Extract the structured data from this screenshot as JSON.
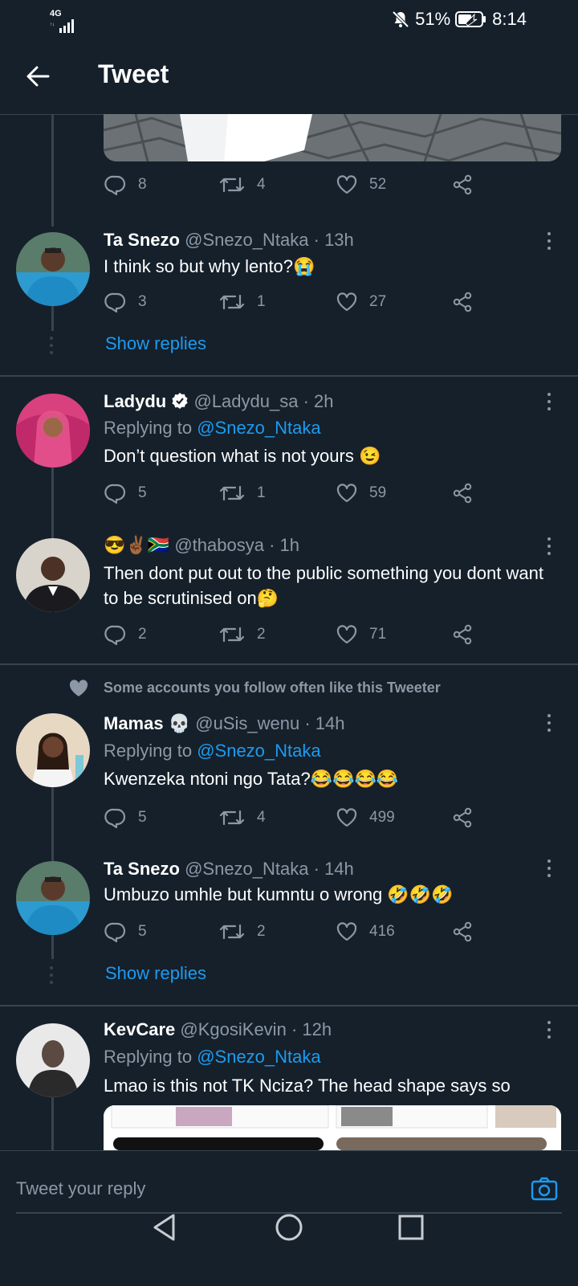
{
  "status_bar": {
    "network": "4G",
    "battery": "51%",
    "time": "8:14"
  },
  "header": {
    "title": "Tweet"
  },
  "top_tweet_actions": {
    "replies": "8",
    "retweets": "4",
    "likes": "52"
  },
  "tweets": [
    {
      "name": "Ta Snezo",
      "handle": "@Snezo_Ntaka",
      "time": "· 13h",
      "replying_prefix": "",
      "replying_handle": "",
      "text": "I think so but why lento?😭",
      "replies": "3",
      "retweets": "1",
      "likes": "27"
    },
    {
      "name": "Ladydu",
      "handle": "@Ladydu_sa",
      "time": "· 2h",
      "replying_prefix": "Replying to",
      "replying_handle": "@Snezo_Ntaka",
      "text": "Don’t question what is not yours 😉",
      "replies": "5",
      "retweets": "1",
      "likes": "59"
    },
    {
      "name": "😎✌🏾🇿🇦",
      "handle": "@thabosya",
      "time": "· 1h",
      "replying_prefix": "",
      "replying_handle": "",
      "text": "Then dont put out to the public something you dont want to be scrutinised on🤔",
      "replies": "2",
      "retweets": "2",
      "likes": "71"
    },
    {
      "name": "Mamas 💀",
      "handle": "@uSis_wenu",
      "time": "· 14h",
      "replying_prefix": "Replying to",
      "replying_handle": "@Snezo_Ntaka",
      "text": "Kwenzeka ntoni ngo Tata?😂😂😂😂",
      "replies": "5",
      "retweets": "4",
      "likes": "499"
    },
    {
      "name": "Ta Snezo",
      "handle": "@Snezo_Ntaka",
      "time": "· 14h",
      "replying_prefix": "",
      "replying_handle": "",
      "text": "Umbuzo umhle but kumntu o wrong 🤣🤣🤣",
      "replies": "5",
      "retweets": "2",
      "likes": "416"
    },
    {
      "name": "KevCare",
      "handle": "@KgosiKevin",
      "time": "· 12h",
      "replying_prefix": "Replying to",
      "replying_handle": "@Snezo_Ntaka",
      "text": "Lmao is this not TK Nciza? The head shape says so",
      "replies": "",
      "retweets": "",
      "likes": ""
    }
  ],
  "show_replies_label": "Show replies",
  "social_context": "Some accounts you follow often like this Tweeter",
  "reply_bar": {
    "placeholder": "Tweet your reply"
  },
  "colors": {
    "background": "#15202b",
    "accent": "#1d9bf0",
    "muted": "#8b98a5",
    "divider": "#38444d"
  }
}
